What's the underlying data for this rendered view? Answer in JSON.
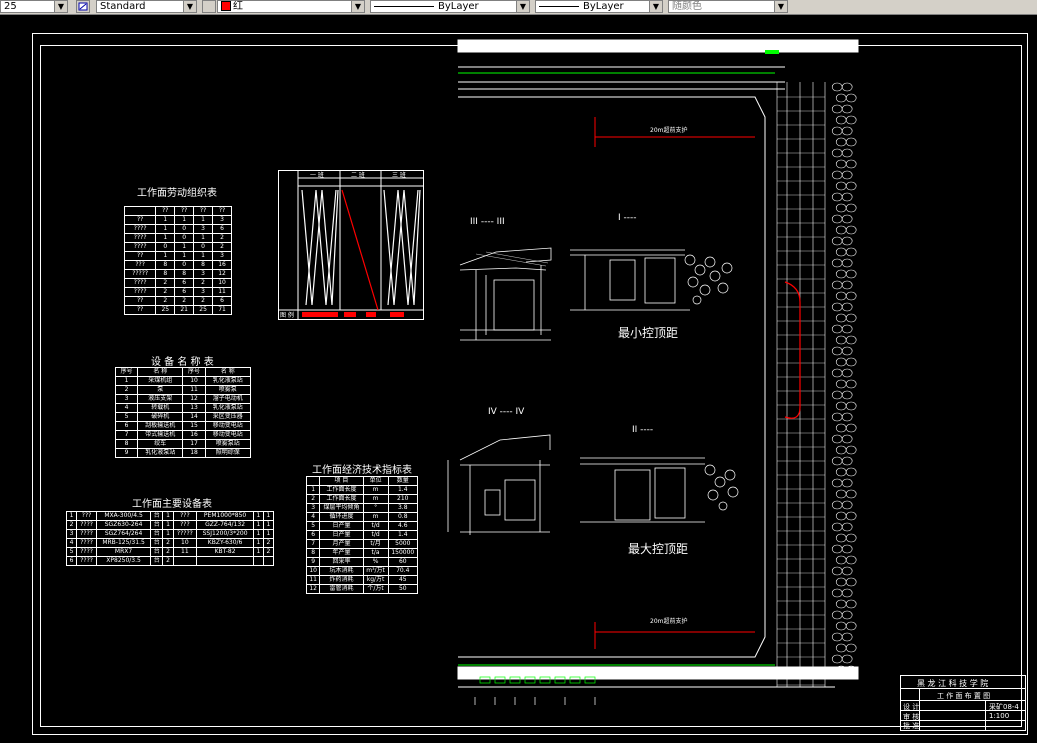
{
  "toolbar": {
    "lineweight_value": "25",
    "textstyle_value": "Standard",
    "color_value": "红",
    "linetype_value": "ByLayer",
    "lineweight2_value": "ByLayer",
    "plotstyle_value": "随颜色"
  },
  "drawing": {
    "labor_table_title": "工作面劳动组织表",
    "labor_table_rows": [
      [
        "??",
        "1",
        "1",
        "1",
        "3"
      ],
      [
        "????",
        "1",
        "0",
        "3",
        "6"
      ],
      [
        "????",
        "1",
        "0",
        "1",
        "2"
      ],
      [
        "????",
        "0",
        "1",
        "0",
        "2"
      ],
      [
        "??",
        "1",
        "1",
        "1",
        "3"
      ],
      [
        "???",
        "8",
        "0",
        "8",
        "16"
      ],
      [
        "?????",
        "8",
        "8",
        "3",
        "12"
      ],
      [
        "????",
        "2",
        "6",
        "2",
        "10"
      ],
      [
        "????",
        "2",
        "6",
        "3",
        "11"
      ],
      [
        "??",
        "2",
        "2",
        "2",
        "6"
      ],
      [
        "??",
        "25",
        "21",
        "25",
        "71"
      ]
    ],
    "labor_table_headers": [
      "??",
      "??",
      "??",
      "??"
    ],
    "chart_headers": [
      "一 班",
      "二 班",
      "三 班"
    ],
    "chart_footer_label": "图 例",
    "section_label_III": "III ---- III",
    "section_label_I": "I ----",
    "section_label_IV": "IV ---- IV",
    "section_label_II": "II ----",
    "min_label": "最小控顶距",
    "max_label": "最大控顶距",
    "support_label_top": "20m超前支护",
    "support_label_bottom": "20m超前支护",
    "equipment_table_title": "设 备 名 称 表",
    "equipment_rows": [
      [
        "1",
        "采煤机组",
        "10",
        "乳化液泵站"
      ],
      [
        "2",
        "泵",
        "11",
        "喷雾泵"
      ],
      [
        "3",
        "液压支架",
        "12",
        "溜子电动机"
      ],
      [
        "4",
        "转载机",
        "13",
        "乳化液泵站"
      ],
      [
        "5",
        "破碎机",
        "14",
        "采区变压器"
      ],
      [
        "6",
        "刮板输送机",
        "15",
        "移动变电站"
      ],
      [
        "7",
        "带式输送机",
        "16",
        "移动变电站"
      ],
      [
        "8",
        "绞车",
        "17",
        "喷雾泵站"
      ],
      [
        "9",
        "乳化液泵站",
        "18",
        "照明综保"
      ]
    ],
    "equipment_headers": [
      "序号",
      "名 称",
      "序号",
      "名 称"
    ],
    "econ_table_title": "工作面经济技术指标表",
    "econ_headers": [
      "",
      "项 目",
      "单位",
      "数量"
    ],
    "econ_rows": [
      [
        "1",
        "工作面长度",
        "m",
        "1.4"
      ],
      [
        "2",
        "工作面长度",
        "m",
        "210"
      ],
      [
        "3",
        "煤层平均倾角",
        "°",
        "3.8"
      ],
      [
        "4",
        "循环进度",
        "m",
        "0.8"
      ],
      [
        "5",
        "日产量",
        "t/d",
        "4.6"
      ],
      [
        "6",
        "日产量",
        "t/d",
        "1.4"
      ],
      [
        "7",
        "月产量",
        "t/月",
        "5000"
      ],
      [
        "8",
        "年产量",
        "t/a",
        "150000"
      ],
      [
        "9",
        "回采率",
        "%",
        "60"
      ],
      [
        "10",
        "坑木消耗",
        "m³/万t",
        "70.4"
      ],
      [
        "11",
        "炸药消耗",
        "kg/万t",
        "45"
      ],
      [
        "12",
        "雷管消耗",
        "个/万t",
        "50"
      ]
    ],
    "main_equipment_title": "工作面主要设备表",
    "main_equipment_rows": [
      [
        "1",
        "???",
        "MXA-300/4.5",
        "台",
        "1",
        "???",
        "PEM1000*850",
        "1",
        "1"
      ],
      [
        "2",
        "????",
        "SGZ630-264",
        "台",
        "1",
        "???",
        "GZZ-764/132",
        "1",
        "1"
      ],
      [
        "3",
        "????",
        "SGZ764/264",
        "台",
        "1",
        "?????",
        "SSJ1200/3*200",
        "1",
        "1"
      ],
      [
        "4",
        "????",
        "MRB-125/31.5",
        "台",
        "2",
        "10",
        "KBZY-630/6",
        "1",
        "2"
      ],
      [
        "5",
        "????",
        "MRX7",
        "台",
        "2",
        "11",
        "KBT-82",
        "1",
        "2"
      ],
      [
        "6",
        "????",
        "XP8250/3.5",
        "台",
        "2",
        "",
        "",
        "",
        ""
      ]
    ],
    "title_block": {
      "school": "黑 龙 江 科 技 学 院",
      "drawing_name": "工 作 面 布 置 图",
      "drawing_no": "采矿08-4",
      "scale": "1:100",
      "row_design": "设 计",
      "row_check": "审 核",
      "row_approve": "批 准"
    }
  },
  "colors": {
    "toolbar_bg": "#d4d0c8",
    "canvas_bg": "#000000",
    "drawing_lines": "#ffffff",
    "accent_red": "#ff0000",
    "accent_green": "#00ff00"
  }
}
